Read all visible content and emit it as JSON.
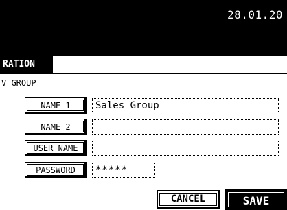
{
  "header": {
    "date": "28.01.20"
  },
  "tab": {
    "label": "RATION"
  },
  "section": {
    "title": "V GROUP"
  },
  "form": {
    "rows": [
      {
        "button": "NAME 1",
        "value": "Sales Group"
      },
      {
        "button": "NAME 2",
        "value": ""
      },
      {
        "button": "USER NAME",
        "value": ""
      },
      {
        "button": "PASSWORD",
        "value": "*****"
      }
    ]
  },
  "footer": {
    "cancel": "CANCEL",
    "save": "SAVE"
  }
}
